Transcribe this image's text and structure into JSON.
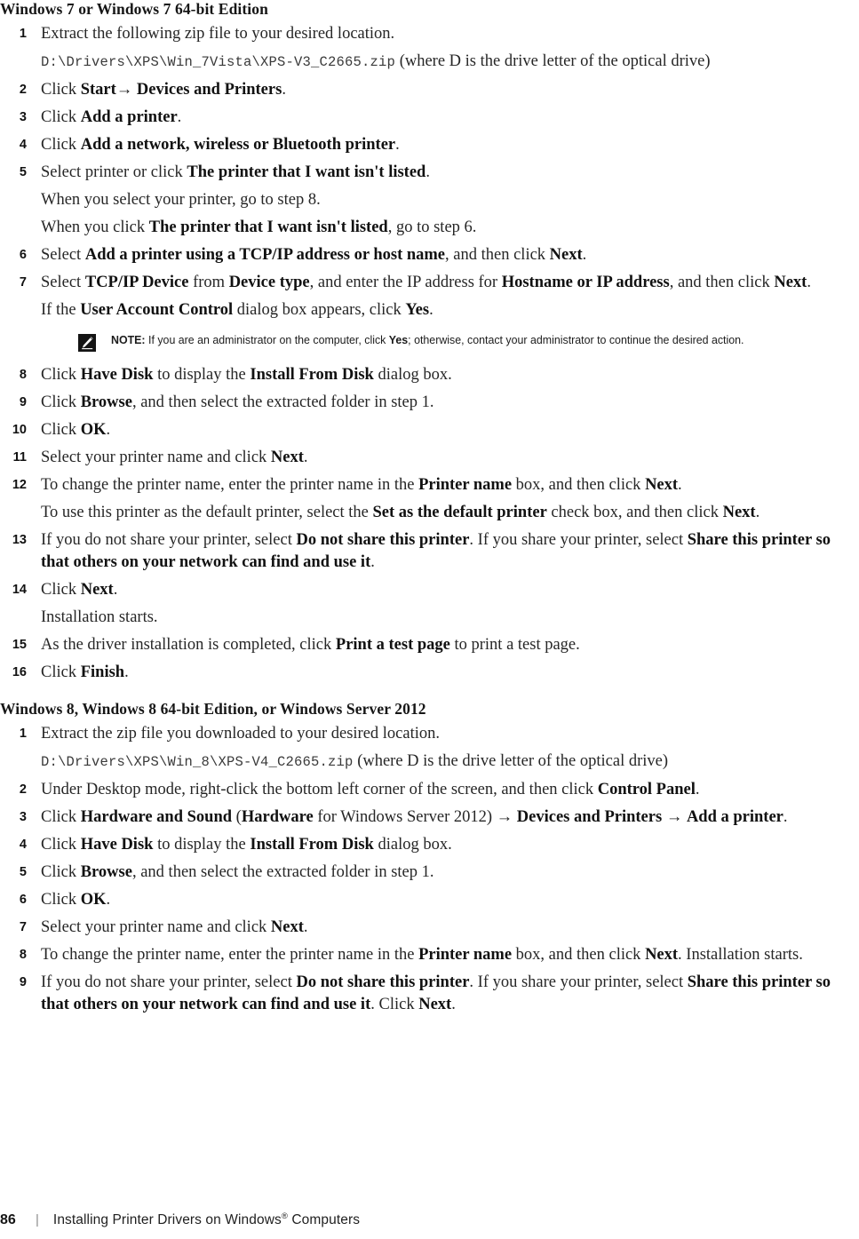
{
  "document": {
    "footer": {
      "page_number": "86",
      "separator": "|",
      "title_before": "Installing Printer Drivers on Windows",
      "title_registered": "®",
      "title_after": " Computers"
    }
  },
  "sections": [
    {
      "heading": "Windows 7 or Windows 7 64-bit Edition",
      "steps": [
        {
          "num": "1",
          "paras": [
            {
              "text": "Extract the following zip file to your desired location."
            },
            {
              "code": "D:\\Drivers\\XPS\\Win_7Vista\\XPS-V3_C2665.zip",
              "after": " (where D is the drive letter of the optical drive)"
            }
          ]
        },
        {
          "num": "2",
          "paras": [
            {
              "pre": "Click ",
              "bold1": "Start",
              "arrow": "→",
              "bold2": " Devices and Printers",
              "post": "."
            }
          ]
        },
        {
          "num": "3",
          "paras": [
            {
              "pre": "Click ",
              "bold1": "Add a printer",
              "post": "."
            }
          ]
        },
        {
          "num": "4",
          "paras": [
            {
              "pre": "Click ",
              "bold1": "Add a network, wireless or Bluetooth printer",
              "post": "."
            }
          ]
        },
        {
          "num": "5",
          "paras": [
            {
              "pre": "Select printer or click ",
              "bold1": "The printer that I want isn't listed",
              "post": "."
            },
            {
              "text": "When you select your printer, go to step 8."
            },
            {
              "pre": "When you click ",
              "bold1": "The printer that I want isn't listed",
              "post": ", go to step 6."
            }
          ]
        },
        {
          "num": "6",
          "paras": [
            {
              "pre": "Select ",
              "bold1": "Add a printer using a TCP/IP address or host name",
              "mid": ", and then click ",
              "bold2": "Next",
              "post": "."
            }
          ]
        },
        {
          "num": "7",
          "paras": [
            {
              "pre": "Select ",
              "bold1": "TCP/IP Device",
              "mid": " from ",
              "bold2": "Device type",
              "mid2": ", and enter the IP address for ",
              "bold3": "Hostname or IP address",
              "mid3": ", and then click ",
              "bold4": "Next",
              "post": "."
            },
            {
              "pre": "If the ",
              "bold1": "User Account Control",
              "mid": " dialog box appears, click ",
              "bold2": "Yes",
              "post": "."
            }
          ],
          "note": {
            "label": "NOTE:",
            "text_before": " If you are an administrator on the computer, click ",
            "bold": "Yes",
            "text_after": "; otherwise, contact your administrator to continue the desired action."
          }
        },
        {
          "num": "8",
          "paras": [
            {
              "pre": "Click ",
              "bold1": "Have Disk",
              "mid": " to display the ",
              "bold2": "Install From Disk",
              "post": " dialog box."
            }
          ]
        },
        {
          "num": "9",
          "paras": [
            {
              "pre": "Click ",
              "bold1": "Browse",
              "post": ", and then select the extracted folder in step 1."
            }
          ]
        },
        {
          "num": "10",
          "paras": [
            {
              "pre": "Click ",
              "bold1": "OK",
              "post": "."
            }
          ]
        },
        {
          "num": "11",
          "paras": [
            {
              "pre": "Select your printer name and click ",
              "bold1": "Next",
              "post": "."
            }
          ]
        },
        {
          "num": "12",
          "paras": [
            {
              "pre": "To change the printer name, enter the printer name in the ",
              "bold1": "Printer name",
              "mid": " box, and then click ",
              "bold2": "Next",
              "post": "."
            },
            {
              "pre": "To use this printer as the default printer, select the ",
              "bold1": "Set as the default printer",
              "mid": " check box, and then click ",
              "bold2": "Next",
              "post": "."
            }
          ]
        },
        {
          "num": "13",
          "paras": [
            {
              "pre": "If you do not share your printer, select ",
              "bold1": "Do not share this printer",
              "mid": ". If you share your printer, select ",
              "bold2": "Share this printer so that others on your network can find and use it",
              "post": "."
            }
          ]
        },
        {
          "num": "14",
          "paras": [
            {
              "pre": "Click ",
              "bold1": "Next",
              "post": "."
            },
            {
              "text": "Installation starts."
            }
          ]
        },
        {
          "num": "15",
          "paras": [
            {
              "pre": "As the driver installation is completed, click ",
              "bold1": "Print a test page",
              "post": " to print a test page."
            }
          ]
        },
        {
          "num": "16",
          "paras": [
            {
              "pre": "Click ",
              "bold1": "Finish",
              "post": "."
            }
          ]
        }
      ]
    },
    {
      "heading": "Windows 8, Windows 8 64-bit Edition, or Windows Server 2012",
      "steps": [
        {
          "num": "1",
          "paras": [
            {
              "text": "Extract the zip file you downloaded to your desired location."
            },
            {
              "code": "D:\\Drivers\\XPS\\Win_8\\XPS-V4_C2665.zip",
              "after": " (where D is the drive letter of the optical drive)"
            }
          ]
        },
        {
          "num": "2",
          "paras": [
            {
              "pre": "Under Desktop mode, right-click the bottom left corner of the screen, and then click ",
              "bold1": "Control Panel",
              "post": "."
            }
          ]
        },
        {
          "num": "3",
          "paras": [
            {
              "pre": "Click ",
              "bold1": "Hardware and Sound",
              "mid": " (",
              "bold2": "Hardware",
              "mid2": " for Windows Server 2012) → ",
              "bold3": "Devices and Printers",
              "mid3": " → ",
              "bold4": "Add a printer",
              "post": "."
            }
          ]
        },
        {
          "num": "4",
          "paras": [
            {
              "pre": "Click ",
              "bold1": "Have Disk",
              "mid": " to display the ",
              "bold2": "Install From Disk",
              "post": " dialog box."
            }
          ]
        },
        {
          "num": "5",
          "paras": [
            {
              "pre": "Click ",
              "bold1": "Browse",
              "post": ", and then select the extracted folder in step 1."
            }
          ]
        },
        {
          "num": "6",
          "paras": [
            {
              "pre": "Click ",
              "bold1": "OK",
              "post": "."
            }
          ]
        },
        {
          "num": "7",
          "paras": [
            {
              "pre": "Select your printer name and click ",
              "bold1": "Next",
              "post": "."
            }
          ]
        },
        {
          "num": "8",
          "paras": [
            {
              "pre": "To change the printer name, enter the printer name in the ",
              "bold1": "Printer name",
              "mid": " box, and then click ",
              "bold2": "Next",
              "post": ". Installation starts."
            }
          ]
        },
        {
          "num": "9",
          "paras": [
            {
              "pre": "If you do not share your printer, select ",
              "bold1": "Do not share this printer",
              "mid": ". If you share your printer, select ",
              "bold2": "Share this printer so that others on your network can find and use it",
              "post": ". Click ",
              "bold3": "Next",
              "post2": "."
            }
          ]
        }
      ]
    }
  ],
  "icons": {
    "note_icon": "pencil-note-icon"
  }
}
